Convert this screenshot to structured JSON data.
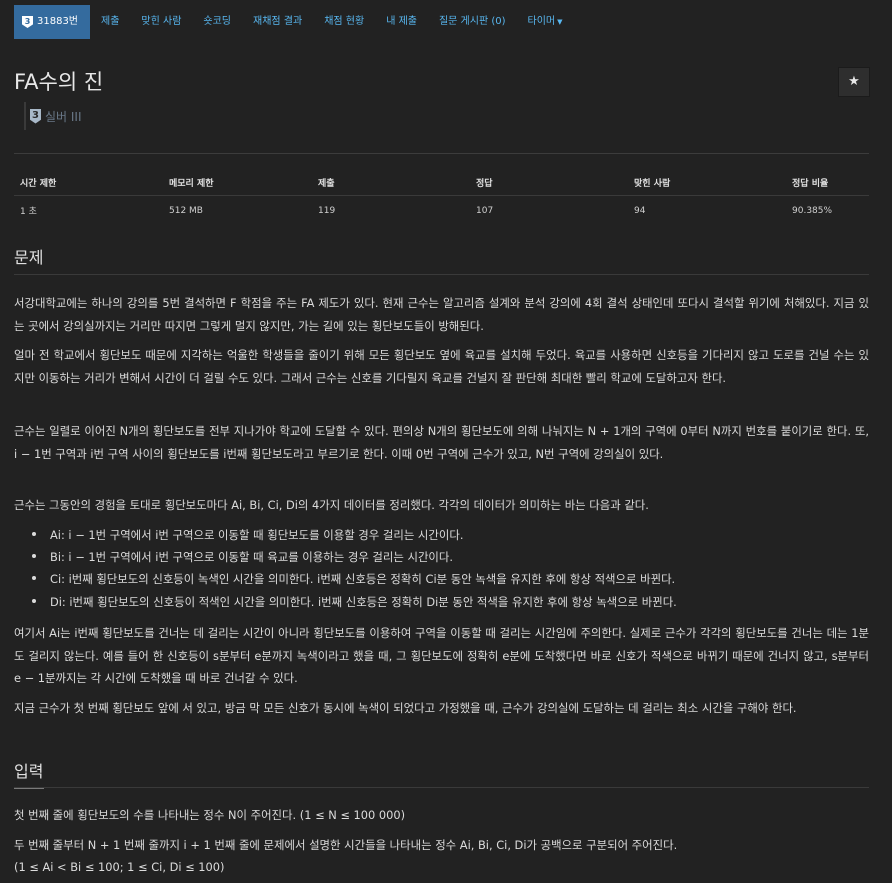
{
  "nav": {
    "problem_number": "31883번",
    "badge_tier": "3",
    "tabs": [
      "제출",
      "맞힌 사람",
      "숏코딩",
      "재채점 결과",
      "채점 현황",
      "내 제출",
      "질문 게시판 (0)",
      "타이머"
    ]
  },
  "title": "FA수의 진",
  "tier": {
    "badge": "3",
    "label": "실버 III"
  },
  "info_table": {
    "headers": [
      "시간 제한",
      "메모리 제한",
      "제출",
      "정답",
      "맞힌 사람",
      "정답 비율"
    ],
    "row": [
      "1 초",
      "512 MB",
      "119",
      "107",
      "94",
      "90.385%"
    ]
  },
  "sections": {
    "problem": "문제",
    "input": "입력"
  },
  "paragraphs": {
    "p1": "서강대학교에는 하나의 강의를 5번 결석하면 F 학점을 주는 FA 제도가 있다. 현재 근수는 알고리즘 설계와 분석 강의에 4회 결석 상태인데 또다시 결석할 위기에 처해있다. 지금 있는 곳에서 강의실까지는 거리만 따지면 그렇게 멀지 않지만, 가는 길에 있는 횡단보도들이 방해된다.",
    "p2": "얼마 전 학교에서 횡단보도 때문에 지각하는 억울한 학생들을 줄이기 위해 모든 횡단보도 옆에 육교를 설치해 두었다. 육교를 사용하면 신호등을 기다리지 않고 도로를 건널 수는 있지만 이동하는 거리가 변해서 시간이 더 걸릴 수도 있다. 그래서 근수는 신호를 기다릴지 육교를 건널지 잘 판단해 최대한 빨리 학교에 도달하고자 한다.",
    "p3": "근수는 일렬로 이어진 N개의 횡단보도를 전부 지나가야 학교에 도달할 수 있다. 편의상 N개의 횡단보도에 의해 나눠지는 N + 1개의 구역에 0부터 N까지 번호를 붙이기로 한다. 또, i − 1번 구역과 i번 구역 사이의 횡단보도를 i번째 횡단보도라고 부르기로 한다. 이때 0번 구역에 근수가 있고, N번 구역에 강의실이 있다.",
    "p4": "근수는 그동안의 경험을 토대로 횡단보도마다 Ai, Bi, Ci, Di의 4가지 데이터를 정리했다. 각각의 데이터가 의미하는 바는 다음과 같다.",
    "li1": "Ai: i − 1번 구역에서 i번 구역으로 이동할 때 횡단보도를 이용할 경우 걸리는 시간이다.",
    "li2": "Bi: i − 1번 구역에서 i번 구역으로 이동할 때 육교를 이용하는 경우 걸리는 시간이다.",
    "li3": "Ci: i번째 횡단보도의 신호등이 녹색인 시간을 의미한다. i번째 신호등은 정확히 Ci분 동안 녹색을 유지한 후에 항상 적색으로 바뀐다.",
    "li4": "Di: i번째 횡단보도의 신호등이 적색인 시간을 의미한다. i번째 신호등은 정확히 Di분 동안 적색을 유지한 후에 항상 녹색으로 바뀐다.",
    "p5": "여기서 Ai는 i번째 횡단보도를 건너는 데 걸리는 시간이 아니라 횡단보도를 이용하여 구역을 이동할 때 걸리는 시간임에 주의한다. 실제로 근수가 각각의 횡단보도를 건너는 데는 1분도 걸리지 않는다. 예를 들어 한 신호등이 s분부터 e분까지 녹색이라고 했을 때, 그 횡단보도에 정확히 e분에 도착했다면 바로 신호가 적색으로 바뀌기 때문에 건너지 않고, s분부터 e − 1분까지는 각 시간에 도착했을 때 바로 건너갈 수 있다.",
    "p6": "지금 근수가 첫 번째 횡단보도 앞에 서 있고, 방금 막 모든 신호가 동시에 녹색이 되었다고 가정했을 때, 근수가 강의실에 도달하는 데 걸리는 최소 시간을 구해야 한다.",
    "in1": "첫 번째 줄에 횡단보도의 수를 나타내는 정수 N이 주어진다. (1 ≤ N ≤ 100 000)",
    "in2": "두 번째 줄부터 N + 1 번째 줄까지 i + 1 번째 줄에 문제에서 설명한 시간들을 나타내는 정수 Ai, Bi, Ci, Di가 공백으로 구분되어 주어진다.",
    "in3": "(1 ≤ Ai < Bi ≤ 100; 1 ≤ Ci, Di ≤ 100)"
  },
  "colors": {
    "background": "#222222",
    "nav_active": "#346b9e",
    "link": "#58b7f0",
    "tier": "#697888"
  },
  "icons": {
    "star": "star-icon",
    "caret": "caret-down-icon",
    "tier_badge": "silver-tier-icon"
  }
}
